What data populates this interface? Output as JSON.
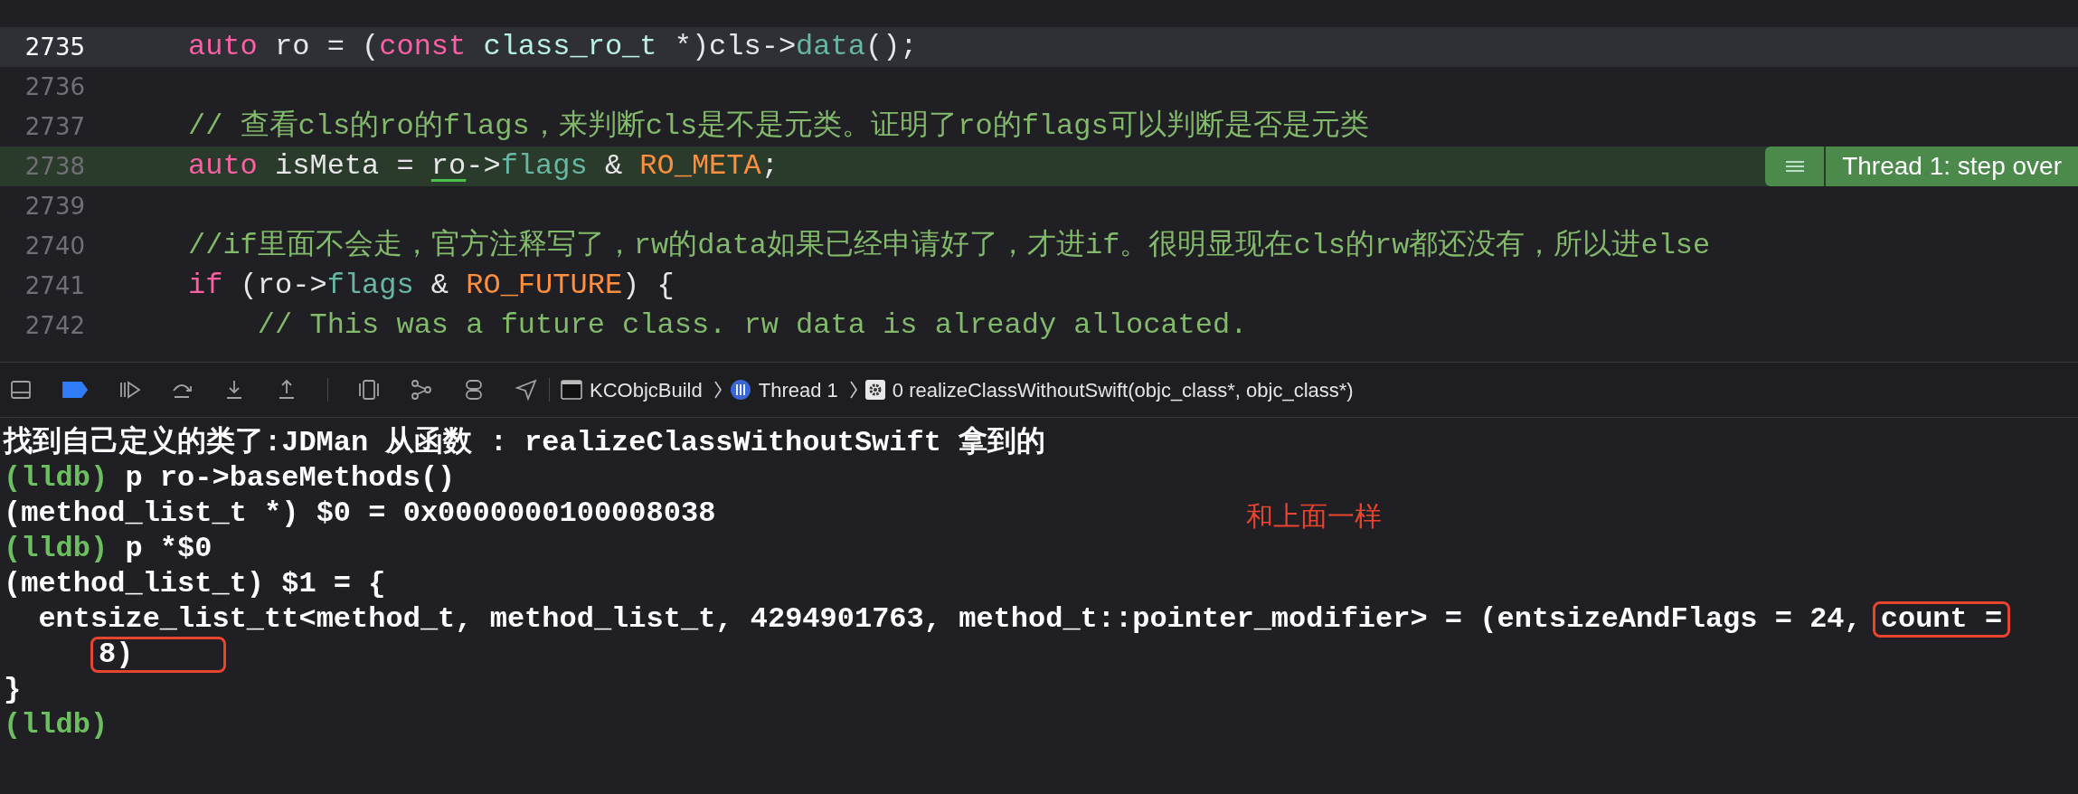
{
  "editor": {
    "lines": [
      {
        "number": "2735",
        "current": true,
        "paused_here": false,
        "segments": [
          {
            "kind": "keyword",
            "text": "auto"
          },
          {
            "kind": "plain",
            "text": " ro = ("
          },
          {
            "kind": "keyword",
            "text": "const "
          },
          {
            "kind": "type",
            "text": "class_ro_t"
          },
          {
            "kind": "plain",
            "text": " *)cls->"
          },
          {
            "kind": "member",
            "text": "data"
          },
          {
            "kind": "plain",
            "text": "();"
          }
        ]
      },
      {
        "number": "2736",
        "current": false,
        "paused_here": false
      },
      {
        "number": "2737",
        "current": false,
        "paused_here": false,
        "segments": [
          {
            "kind": "comment",
            "text": "// 查看cls的ro的flags，来判断cls是不是元类。证明了ro的flags可以判断是否是元类"
          }
        ]
      },
      {
        "number": "2738",
        "current": false,
        "paused_here": true,
        "segments": [
          {
            "kind": "keyword",
            "text": "auto"
          },
          {
            "kind": "plain",
            "text": " isMeta = "
          },
          {
            "kind": "plain",
            "text": "ro",
            "underlined": true
          },
          {
            "kind": "plain",
            "text": "->"
          },
          {
            "kind": "member",
            "text": "flags"
          },
          {
            "kind": "plain",
            "text": " & "
          },
          {
            "kind": "constant",
            "text": "RO_META"
          },
          {
            "kind": "plain",
            "text": ";"
          }
        ]
      },
      {
        "number": "2739",
        "current": false,
        "paused_here": false
      },
      {
        "number": "2740",
        "current": false,
        "paused_here": false,
        "segments": [
          {
            "kind": "comment",
            "text": "//if里面不会走，官方注释写了，rw的data如果已经申请好了，才进if。很明显现在cls的rw都还没有，所以进else"
          }
        ]
      },
      {
        "number": "2741",
        "current": false,
        "paused_here": false,
        "segments": [
          {
            "kind": "keyword",
            "text": "if"
          },
          {
            "kind": "plain",
            "text": " (ro->"
          },
          {
            "kind": "member",
            "text": "flags"
          },
          {
            "kind": "plain",
            "text": " & "
          },
          {
            "kind": "constant",
            "text": "RO_FUTURE"
          },
          {
            "kind": "plain",
            "text": ") {"
          }
        ]
      },
      {
        "number": "2742",
        "current": false,
        "paused_here": false,
        "segments": [
          {
            "kind": "comment",
            "text": "    // This was a future class. rw data is already allocated."
          }
        ]
      }
    ],
    "thread_badge": "Thread 1: step over"
  },
  "debug_bar": {
    "breakpoints_active": true,
    "breadcrumbs": [
      {
        "kind": "app",
        "label": "KCObjcBuild"
      },
      {
        "kind": "thread",
        "label": "Thread 1"
      },
      {
        "kind": "frame",
        "label": "0 realizeClassWithoutSwift(objc_class*, objc_class*)"
      }
    ]
  },
  "console": {
    "lines": [
      [
        {
          "kind": "output",
          "text": "找到自己定义的类了:JDMan 从函数 : realizeClassWithoutSwift 拿到的"
        }
      ],
      [
        {
          "kind": "prompt",
          "text": "(lldb)"
        },
        {
          "kind": "output",
          "text": " p ro->baseMethods()"
        }
      ],
      [
        {
          "kind": "output",
          "text": "(method_list_t *) $0 = 0x0000000100008038"
        }
      ],
      [
        {
          "kind": "prompt",
          "text": "(lldb)"
        },
        {
          "kind": "output",
          "text": " p *$0"
        }
      ],
      [
        {
          "kind": "output",
          "text": "(method_list_t) $1 = {"
        }
      ],
      [
        {
          "kind": "output",
          "text": "  entsize_list_tt<method_t, method_list_t, 4294901763, method_t::pointer_modifier> = (entsizeAndFlags = 24,"
        },
        {
          "kind": "boxed",
          "text": "count ="
        }
      ],
      [
        {
          "kind": "boxed",
          "text": "8)"
        }
      ],
      [
        {
          "kind": "output",
          "text": "}"
        }
      ],
      [
        {
          "kind": "prompt",
          "text": "(lldb)"
        }
      ]
    ],
    "annotation": "和上面一样"
  }
}
